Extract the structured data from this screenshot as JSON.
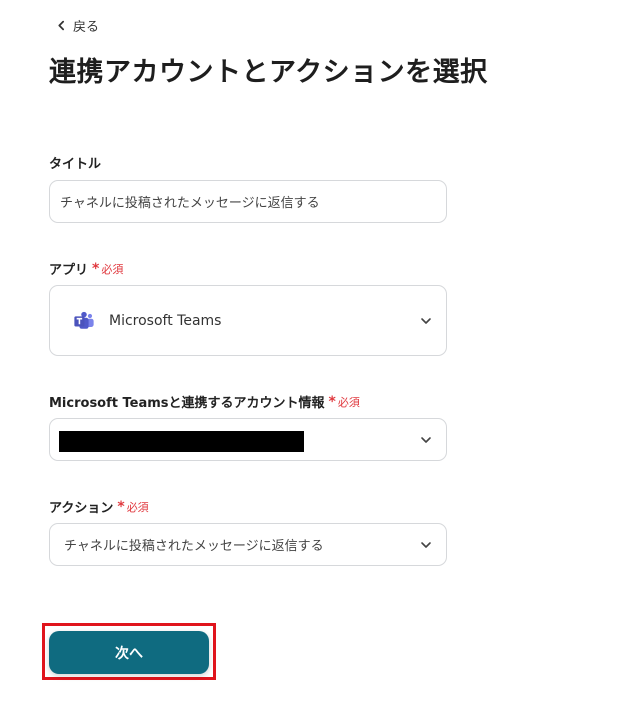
{
  "nav": {
    "back_label": "戻る"
  },
  "page": {
    "title": "連携アカウントとアクションを選択"
  },
  "form": {
    "required_label": "必須",
    "title_field": {
      "label": "タイトル",
      "value": "チャネルに投稿されたメッセージに返信する"
    },
    "app_field": {
      "label": "アプリ",
      "value": "Microsoft Teams",
      "icon": "microsoft-teams-icon"
    },
    "account_field": {
      "label": "Microsoft Teamsと連携するアカウント情報",
      "value_redacted": true
    },
    "action_field": {
      "label": "アクション",
      "value": "チャネルに投稿されたメッセージに返信する"
    }
  },
  "next_button": {
    "label": "次へ",
    "color": "#0f6b80",
    "highlight_color": "#e0141c"
  }
}
